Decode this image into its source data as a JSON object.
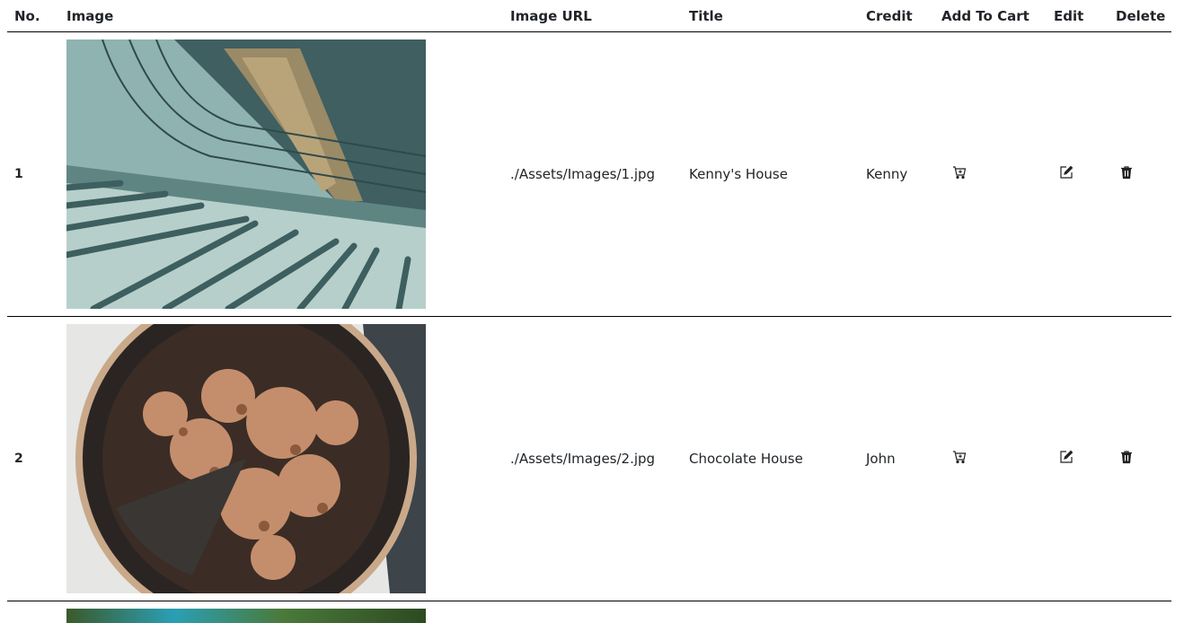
{
  "headers": {
    "no": "No.",
    "image": "Image",
    "url": "Image URL",
    "title": "Title",
    "credit": "Credit",
    "cart": "Add To Cart",
    "edit": "Edit",
    "delete": "Delete"
  },
  "rows": [
    {
      "no": "1",
      "image_icon": "staircase-photo",
      "url": "./Assets/Images/1.jpg",
      "title": "Kenny's House",
      "credit": "Kenny"
    },
    {
      "no": "2",
      "image_icon": "chocolate-cake-photo",
      "url": "./Assets/Images/2.jpg",
      "title": "Chocolate House",
      "credit": "John"
    }
  ],
  "icons": {
    "cart": "cart-icon",
    "edit": "edit-icon",
    "delete": "trash-icon"
  }
}
